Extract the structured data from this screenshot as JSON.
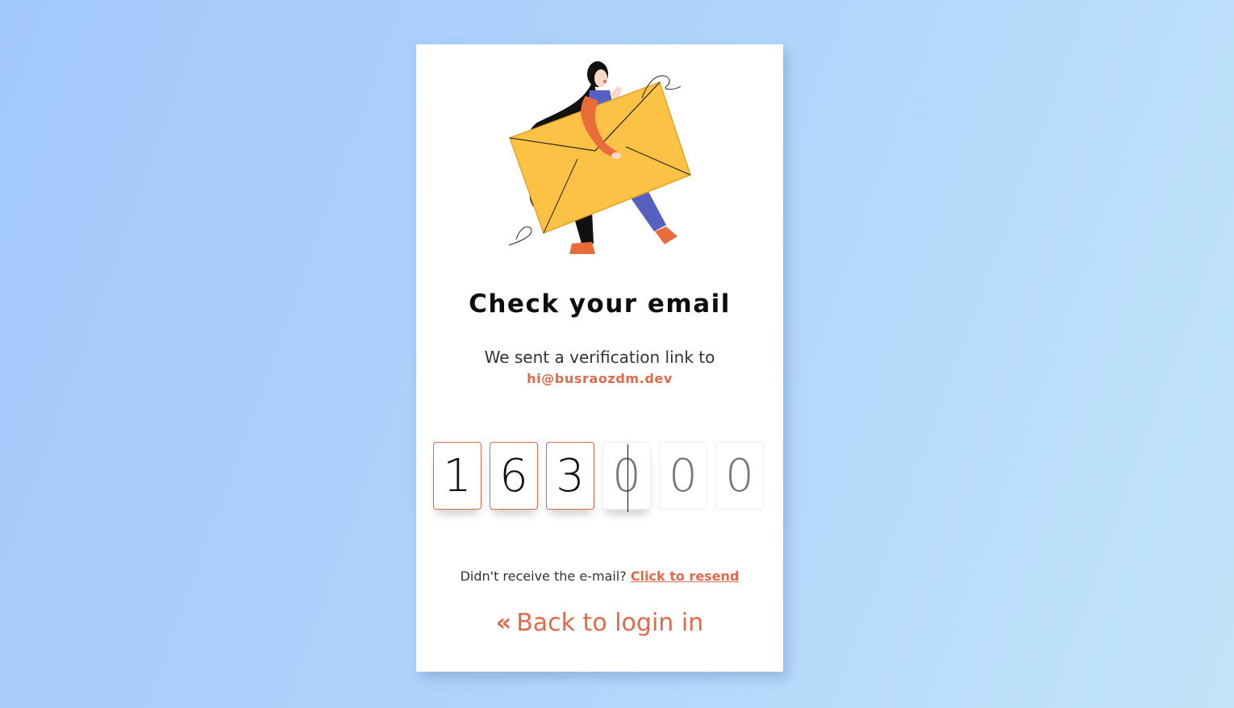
{
  "colors": {
    "accent": "#e06a4a",
    "envelope": "#fcc245",
    "sleeve": "#e86c3a",
    "pants": "#5660c0",
    "hair": "#111111"
  },
  "card": {
    "title": "Check your email",
    "subtitle": "We sent a verification link to",
    "email": "hi@busraozdm.dev",
    "otp": [
      {
        "digit": "1",
        "state": "filled"
      },
      {
        "digit": "6",
        "state": "filled"
      },
      {
        "digit": "3",
        "state": "filled"
      },
      {
        "digit": "0",
        "state": "active"
      },
      {
        "digit": "0",
        "state": "empty"
      },
      {
        "digit": "0",
        "state": "empty"
      }
    ],
    "resend_prompt": "Didn't receive the e-mail?",
    "resend_link": "Click to resend",
    "back_icon": "double-chevron-left-icon",
    "back_label": "Back to login in"
  }
}
